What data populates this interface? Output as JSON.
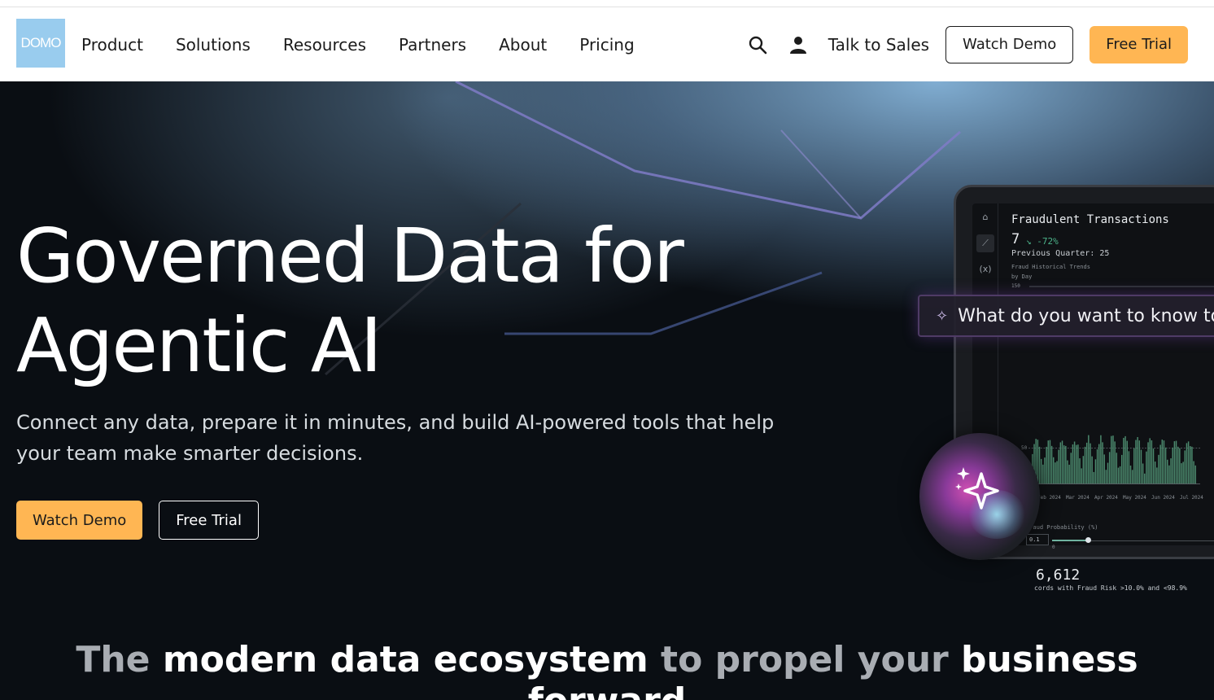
{
  "nav": {
    "logo": "DOMO",
    "menu": [
      "Product",
      "Solutions",
      "Resources",
      "Partners",
      "About",
      "Pricing"
    ],
    "talk_to_sales": "Talk to Sales",
    "watch_demo": "Watch Demo",
    "free_trial": "Free Trial"
  },
  "hero": {
    "title_line1": "Governed Data for",
    "title_line2": "Agentic AI",
    "subtitle": "Connect any data, prepare it in minutes, and build AI-powered tools that help your team make smarter decisions.",
    "watch_demo": "Watch Demo",
    "free_trial": "Free Trial"
  },
  "dashboard": {
    "title": "Fraudulent Transactions",
    "value": "7",
    "delta": "↘ -72%",
    "previous": "Previous Quarter: 25",
    "trend_label": "Fraud Historical Trends",
    "trend_sub": "by Day",
    "y_ticks": [
      "150",
      "50",
      "0"
    ],
    "x_ticks": [
      "Feb 2024",
      "Mar 2024",
      "Apr 2024",
      "May 2024",
      "Jun 2024",
      "Jul 2024"
    ],
    "fraud_probability_label": "Fraud Probability (%)",
    "fraud_probability_value": "0.1",
    "slider_min": "0",
    "count": "6,612",
    "count_caption": "cords with Fraud Risk >10.0% and <98.9%"
  },
  "prompt": {
    "text": "What do you want to know tod"
  },
  "tagline": {
    "part1": "The ",
    "part2": "modern data ecosystem",
    "part3": " to propel your ",
    "part4": "business forward"
  },
  "colors": {
    "accent_orange": "#ffb653",
    "logo_blue": "#99ccee",
    "hero_bg": "#0a0e13",
    "chart_green": "#4c8a6e"
  }
}
